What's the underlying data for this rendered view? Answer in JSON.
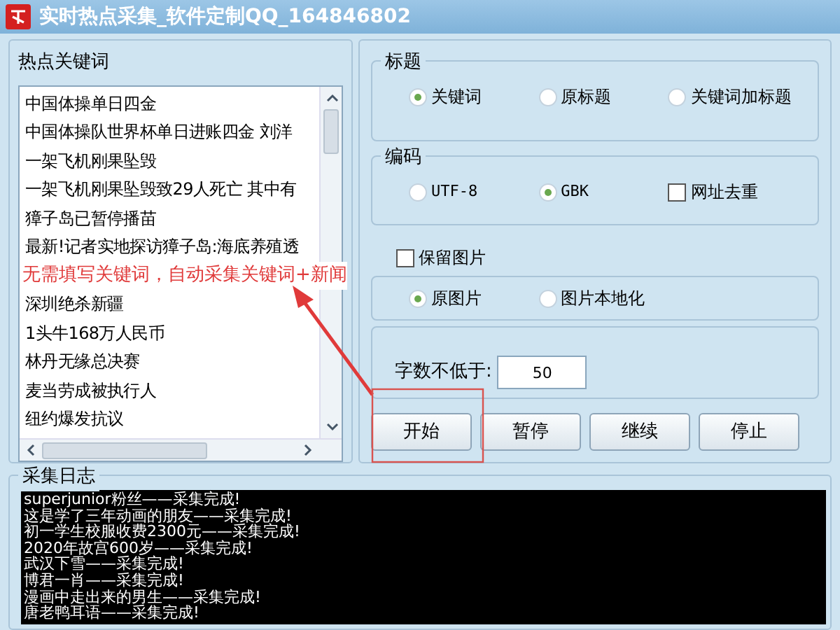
{
  "window": {
    "title": "实时热点采集_软件定制QQ_164846802"
  },
  "keywords_panel": {
    "label": "热点关键词",
    "items": [
      {
        "kind": "keyword",
        "text": "中国体操单日四金"
      },
      {
        "kind": "keyword",
        "text": "中国体操队世界杯单日进账四金 刘洋"
      },
      {
        "kind": "keyword",
        "text": "一架飞机刚果坠毁"
      },
      {
        "kind": "keyword",
        "text": "一架飞机刚果坠毁致29人死亡 其中有"
      },
      {
        "kind": "keyword",
        "text": "獐子岛已暂停播苗"
      },
      {
        "kind": "keyword",
        "text": "最新!记者实地探访獐子岛:海底养殖透"
      },
      {
        "kind": "annotation",
        "text": "无需填写关键词，自动采集关键词+新闻"
      },
      {
        "kind": "keyword",
        "text": "深圳绝杀新疆"
      },
      {
        "kind": "keyword",
        "text": "1头牛168万人民币"
      },
      {
        "kind": "keyword",
        "text": "林丹无缘总决赛"
      },
      {
        "kind": "keyword",
        "text": "麦当劳成被执行人"
      },
      {
        "kind": "keyword",
        "text": "纽约爆发抗议"
      }
    ]
  },
  "title_group": {
    "label": "标题",
    "options": [
      {
        "label": "关键词",
        "selected": true
      },
      {
        "label": "原标题",
        "selected": false
      },
      {
        "label": "关键词加标题",
        "selected": false
      }
    ]
  },
  "encoding_group": {
    "label": "编码",
    "options": [
      {
        "label": "UTF-8",
        "selected": false
      },
      {
        "label": "GBK",
        "selected": true
      }
    ],
    "dedupe": {
      "label": "网址去重",
      "checked": false
    }
  },
  "keep_images": {
    "label": "保留图片",
    "checked": false
  },
  "image_group": {
    "options": [
      {
        "label": "原图片",
        "selected": true
      },
      {
        "label": "图片本地化",
        "selected": false
      }
    ]
  },
  "min_chars": {
    "label": "字数不低于:",
    "value": "50"
  },
  "buttons": [
    "开始",
    "暂停",
    "继续",
    "停止"
  ],
  "log": {
    "label": "采集日志",
    "lines": [
      "superjunior粉丝——采集完成!",
      "这是学了三年动画的朋友——采集完成!",
      "初一学生校服收费2300元——采集完成!",
      "2020年故宫600岁——采集完成!",
      "武汉下雪——采集完成!",
      "博君一肖——采集完成!",
      "漫画中走出来的男生——采集完成!",
      "唐老鸭耳语——采集完成!"
    ]
  }
}
